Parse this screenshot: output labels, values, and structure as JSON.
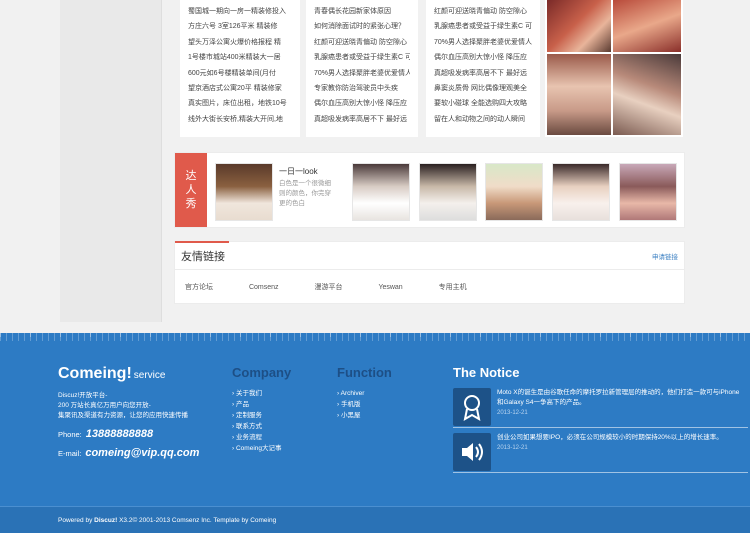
{
  "top_columns": [
    [
      "蜀国城一期向一房一精装修投入",
      "方庄六号 3室126平米 精装修",
      "望头万泽公寓火爆价格报程 精",
      "1号楼市城站400米精装大一居",
      "600元如6号楼精装单间(月付",
      "望京酒店式公寓20平 精装修家",
      "真实图片，床位出租，地铁10号",
      "线外大街长安桥,精装大开间,地"
    ],
    [
      "青春偶长花园新家体原因",
      "如何消除面试时的紧张心理？",
      "红颜可迎送晓青偏动 防空隙心",
      "乳腺癌患者或受益于绿生素C 可",
      "70%男人选择聚胖老婆优爱情人",
      "专家教你防治驾驶员中头疾",
      "偶尔血压高别大惊小怪 降压应",
      "真超吸发病率高居不下 最好远"
    ],
    [
      "红颜可迎送晓青偏动 防空隙心",
      "乳腺癌患者或受益于绿生素C 可",
      "70%男人选择聚胖老婆优爱情人",
      "偶尔血压高别大惊小怪 降压应",
      "真超吸发病率高居不下 最好远",
      "鼻窦炎质骨 网比偶像理观美全",
      "要软小碰球 全能选购四大攻略",
      "留在人和动物之间的动人瞬间"
    ]
  ],
  "talent": {
    "tag": "达人秀",
    "title": "一日一look",
    "desc": [
      "白色是一个很微细",
      "则的颜色，你完穿",
      "更的色白"
    ]
  },
  "links": {
    "title": "友情链接",
    "apply": "申请链接",
    "items": [
      "官方论坛",
      "Comsenz",
      "漫游平台",
      "Yeswan",
      "专用主机"
    ]
  },
  "footer": {
    "brand": "Comeing!",
    "brand_suffix": "service",
    "brand_lines": [
      "Discuz!开放平台-",
      "200 万站长真亿万用户向您开放-",
      "集聚讯及渠道有力资源，让您的应用快速传播"
    ],
    "phone_label": "Phone:",
    "phone": "13888888888",
    "email_label": "E-mail:",
    "email": "comeing@vip.qq.com",
    "company_title": "Company",
    "company_items": [
      "关于我们",
      "产品",
      "定制服务",
      "联系方式",
      "业务流程",
      "Comeing大记事"
    ],
    "function_title": "Function",
    "function_items": [
      "Archiver",
      "手机版",
      "小黑屋"
    ],
    "notice_title": "The Notice",
    "notices": [
      {
        "text": "Moto X的诞生是由谷歌任命的摩托罗拉新管理层的推动的，他们打造一款可与iPhone和Galaxy S4一争高下的产品。",
        "date": "2013-12-21"
      },
      {
        "text": "创业公司如果想要IPO，必须在公司规模较小的时期保持20%以上的增长速率。",
        "date": "2013-12-21"
      }
    ],
    "copyright_prefix": "Powered by",
    "copyright_brand": "Discuz!",
    "copyright_rest": "X3.2© 2001-2013 Comsenz Inc.  Template by Comeing"
  },
  "colors": {
    "footer_blue": "#2d7bc4",
    "accent_red": "#e05a4b",
    "dark_blue": "#1d4f86"
  }
}
